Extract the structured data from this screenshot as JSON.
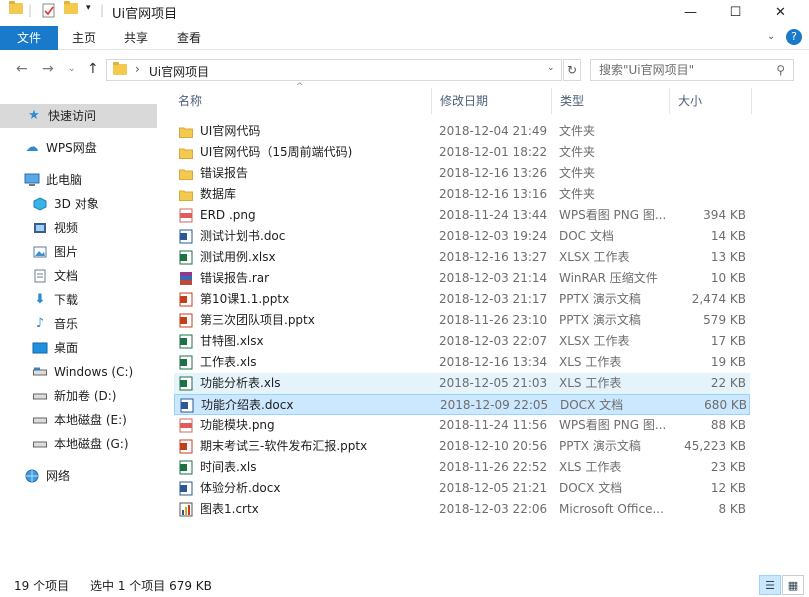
{
  "window": {
    "title": "Ui官网项目",
    "controls": {
      "minimize": "—",
      "maximize": "☐",
      "close": "✕"
    }
  },
  "ribbon": {
    "tabs": [
      {
        "label": "文件"
      },
      {
        "label": "主页"
      },
      {
        "label": "共享"
      },
      {
        "label": "查看"
      }
    ],
    "help_icon": "?"
  },
  "address": {
    "path": "Ui官网项目",
    "separator": "›",
    "search_placeholder": "搜索\"Ui官网项目\""
  },
  "sidebar": {
    "items": [
      {
        "label": "快速访问",
        "icon": "star-icon"
      },
      {
        "label": "WPS网盘",
        "icon": "cloud-icon"
      },
      {
        "label": "此电脑",
        "icon": "pc-icon"
      },
      {
        "label": "3D 对象",
        "icon": "cube-icon"
      },
      {
        "label": "视频",
        "icon": "video-icon"
      },
      {
        "label": "图片",
        "icon": "picture-icon"
      },
      {
        "label": "文档",
        "icon": "document-icon"
      },
      {
        "label": "下载",
        "icon": "download-icon"
      },
      {
        "label": "音乐",
        "icon": "music-icon"
      },
      {
        "label": "桌面",
        "icon": "desktop-icon"
      },
      {
        "label": "Windows (C:)",
        "icon": "drive-icon"
      },
      {
        "label": "新加卷 (D:)",
        "icon": "drive-icon"
      },
      {
        "label": "本地磁盘 (E:)",
        "icon": "drive-icon"
      },
      {
        "label": "本地磁盘 (G:)",
        "icon": "drive-icon"
      },
      {
        "label": "网络",
        "icon": "network-icon"
      }
    ]
  },
  "columns": {
    "name": "名称",
    "date": "修改日期",
    "type": "类型",
    "size": "大小"
  },
  "files": [
    {
      "name": "UI官网代码",
      "date": "2018-12-04 21:49",
      "type": "文件夹",
      "size": "",
      "icon": "folder"
    },
    {
      "name": "UI官网代码（15周前端代码)",
      "date": "2018-12-01 18:22",
      "type": "文件夹",
      "size": "",
      "icon": "folder"
    },
    {
      "name": "错误报告",
      "date": "2018-12-16 13:26",
      "type": "文件夹",
      "size": "",
      "icon": "folder"
    },
    {
      "name": "数据库",
      "date": "2018-12-16 13:16",
      "type": "文件夹",
      "size": "",
      "icon": "folder"
    },
    {
      "name": "ERD .png",
      "date": "2018-11-24 13:44",
      "type": "WPS看图 PNG 图...",
      "size": "394 KB",
      "icon": "png"
    },
    {
      "name": "测试计划书.doc",
      "date": "2018-12-03 19:24",
      "type": "DOC 文档",
      "size": "14 KB",
      "icon": "doc"
    },
    {
      "name": "测试用例.xlsx",
      "date": "2018-12-16 13:27",
      "type": "XLSX 工作表",
      "size": "13 KB",
      "icon": "xls"
    },
    {
      "name": "错误报告.rar",
      "date": "2018-12-03 21:14",
      "type": "WinRAR 压缩文件",
      "size": "10 KB",
      "icon": "rar"
    },
    {
      "name": "第10课1.1.pptx",
      "date": "2018-12-03 21:17",
      "type": "PPTX 演示文稿",
      "size": "2,474 KB",
      "icon": "ppt"
    },
    {
      "name": "第三次团队项目.pptx",
      "date": "2018-11-26 23:10",
      "type": "PPTX 演示文稿",
      "size": "579 KB",
      "icon": "ppt"
    },
    {
      "name": "甘特图.xlsx",
      "date": "2018-12-03 22:07",
      "type": "XLSX 工作表",
      "size": "17 KB",
      "icon": "xls"
    },
    {
      "name": "工作表.xls",
      "date": "2018-12-16 13:34",
      "type": "XLS 工作表",
      "size": "19 KB",
      "icon": "xls"
    },
    {
      "name": "功能分析表.xls",
      "date": "2018-12-05 21:03",
      "type": "XLS 工作表",
      "size": "22 KB",
      "icon": "xls",
      "state": "hover"
    },
    {
      "name": "功能介绍表.docx",
      "date": "2018-12-09 22:05",
      "type": "DOCX 文档",
      "size": "680 KB",
      "icon": "doc",
      "state": "selected"
    },
    {
      "name": "功能模块.png",
      "date": "2018-11-24 11:56",
      "type": "WPS看图 PNG 图...",
      "size": "88 KB",
      "icon": "png"
    },
    {
      "name": "期末考试三-软件发布汇报.pptx",
      "date": "2018-12-10 20:56",
      "type": "PPTX 演示文稿",
      "size": "45,223 KB",
      "icon": "ppt"
    },
    {
      "name": "时间表.xls",
      "date": "2018-11-26 22:52",
      "type": "XLS 工作表",
      "size": "23 KB",
      "icon": "xls"
    },
    {
      "name": "体验分析.docx",
      "date": "2018-12-05 21:21",
      "type": "DOCX 文档",
      "size": "12 KB",
      "icon": "doc"
    },
    {
      "name": "图表1.crtx",
      "date": "2018-12-03 22:06",
      "type": "Microsoft Office...",
      "size": "8 KB",
      "icon": "crtx"
    }
  ],
  "status": {
    "count": "19 个项目",
    "selection": "选中 1 个项目  679 KB"
  },
  "colors": {
    "accent": "#1979ca",
    "selected_bg": "#cce8ff",
    "hover_bg": "#e5f3fb",
    "folder": "#f3c950"
  }
}
